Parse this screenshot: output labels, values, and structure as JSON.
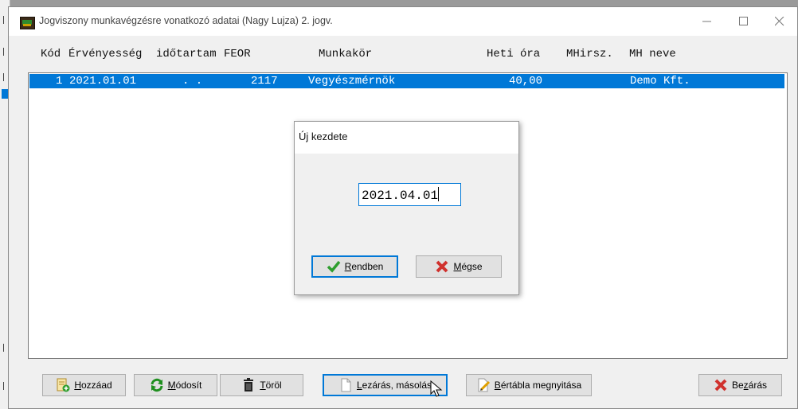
{
  "window": {
    "title": "Jogviszony munkavégzésre vonatkozó adatai (Nagy Lujza) 2. jogv.",
    "controls": [
      "minimize-icon",
      "maximize-icon",
      "close-icon"
    ]
  },
  "columns": {
    "kod": "Kód",
    "ervenyesseg": "Érvényesség",
    "idotartam": "időtartam",
    "feor": "FEOR",
    "munkakor": "Munkakör",
    "heti_ora": "Heti óra",
    "mhirsz": "MHirsz.",
    "mh_neve": "MH neve"
  },
  "rows": [
    {
      "kod": "1",
      "ervenyesseg": "2021.01.01",
      "idotartam": ". .",
      "feor": "2117",
      "munkakor": "Vegyészmérnök",
      "heti_ora": "40,00",
      "mhirsz": "",
      "mh_neve": "Demo Kft."
    }
  ],
  "dialog": {
    "title": "Új kezdete",
    "input_value": "2021.04.01",
    "ok": {
      "accel": "R",
      "rest": "endben",
      "icon": "checkmark-icon"
    },
    "cancel": {
      "pre": "",
      "accel": "M",
      "rest": "égse",
      "icon": "red-x-icon"
    }
  },
  "buttons": {
    "add": {
      "accel": "H",
      "rest": "ozzáad",
      "icon": "add-document-icon"
    },
    "modify": {
      "accel": "M",
      "rest": "ódosít",
      "icon": "refresh-icon"
    },
    "delete": {
      "accel": "T",
      "rest": "öröl",
      "icon": "trash-icon"
    },
    "close_copy": {
      "accel": "L",
      "rest": "ezárás, másolás",
      "icon": "document-icon"
    },
    "open_table": {
      "accel": "B",
      "rest": "értábla megnyitása",
      "icon": "edit-document-icon"
    },
    "close": {
      "pre": "Be",
      "accel": "z",
      "rest": "árás",
      "icon": "red-x-icon"
    }
  },
  "colors": {
    "selection": "#0078d7",
    "accent_red": "#d0312d",
    "accent_green": "#2e9e2e"
  }
}
